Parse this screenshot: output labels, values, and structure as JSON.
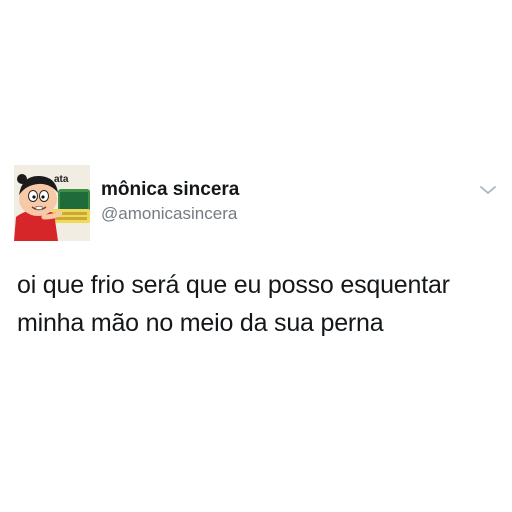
{
  "tweet": {
    "author": {
      "display_name": "mônica sincera",
      "handle": "@amonicasincera",
      "avatar_caption": "ata"
    },
    "text_lines": [
      "oi que frio será que eu posso esquentar",
      "minha mão no meio da sua perna"
    ],
    "menu_icon": "chevron-down-icon"
  }
}
